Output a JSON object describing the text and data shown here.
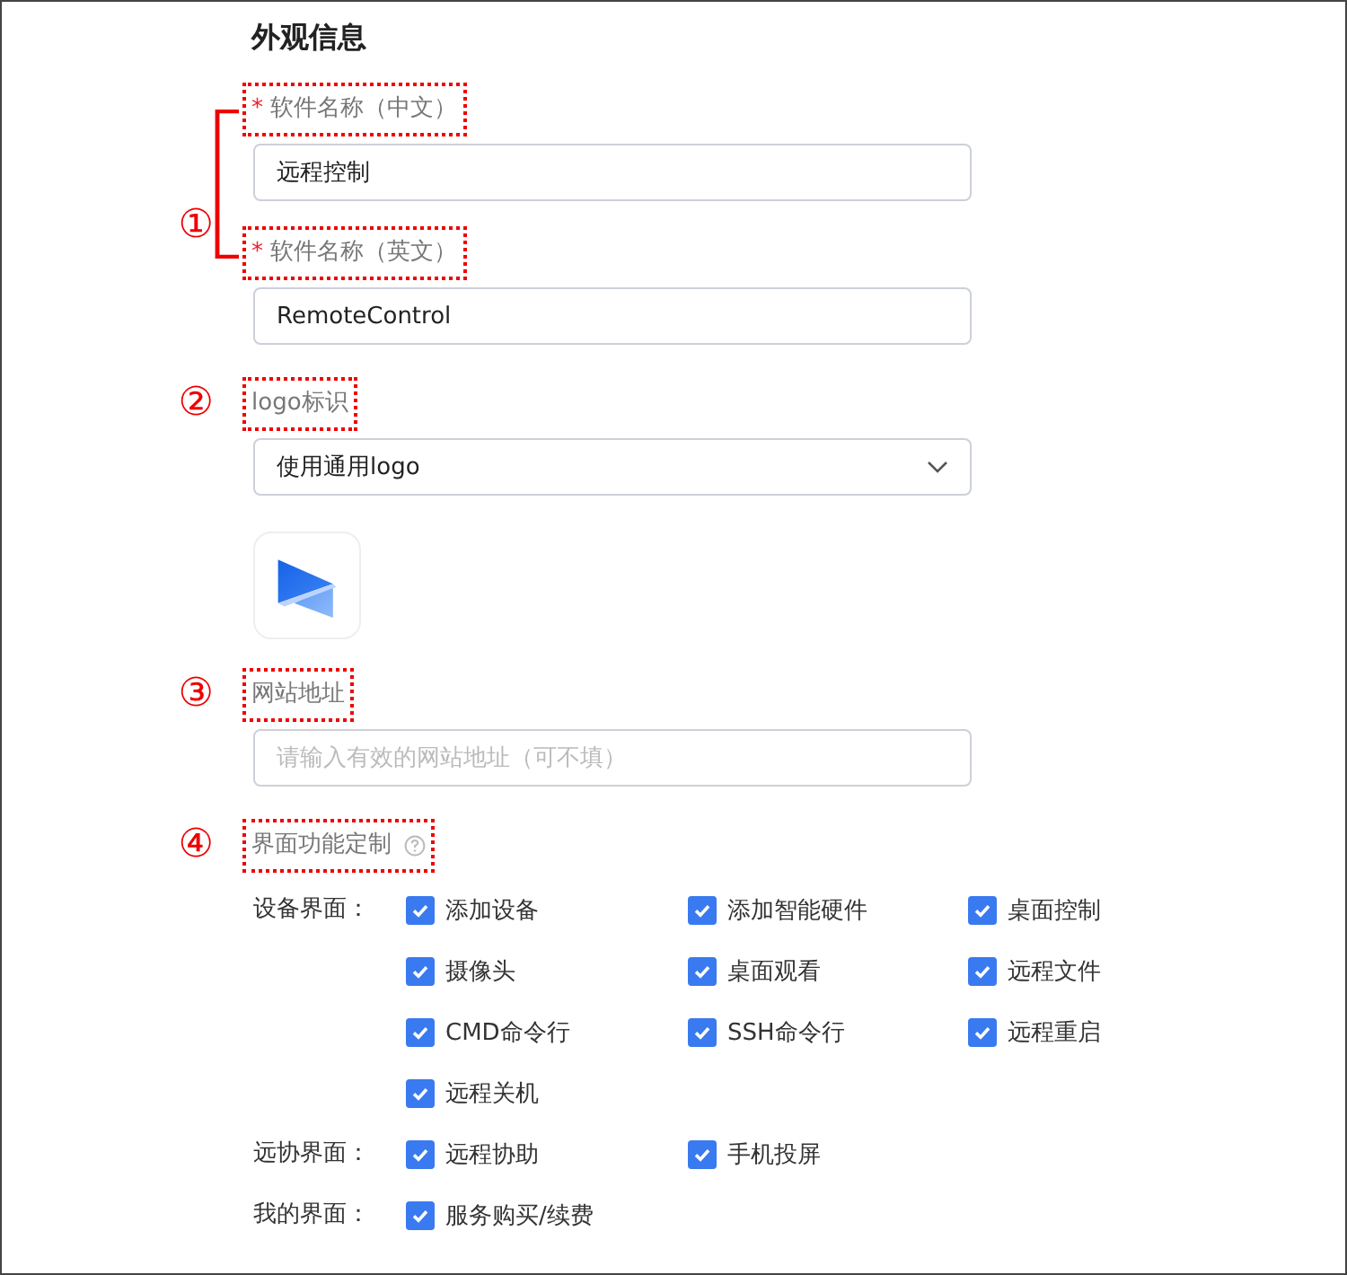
{
  "title": "外观信息",
  "sections": [
    {
      "marker": "①",
      "bracket": true,
      "fields": [
        {
          "kind": "text",
          "label": "软件名称（中文）",
          "required_mark": "*",
          "value": "远程控制"
        },
        {
          "kind": "text",
          "label": "软件名称（英文）",
          "required_mark": "*",
          "value": "RemoteControl"
        }
      ]
    },
    {
      "marker": "②",
      "bracket": false,
      "fields": [
        {
          "kind": "select",
          "label": "logo标识",
          "value": "使用通用logo"
        },
        {
          "kind": "logo"
        }
      ]
    },
    {
      "marker": "③",
      "bracket": false,
      "fields": [
        {
          "kind": "text",
          "label": "网站地址",
          "placeholder": "请输入有效的网站地址（可不填）"
        }
      ]
    },
    {
      "marker": "④",
      "bracket": false,
      "fields": [
        {
          "kind": "checks",
          "label": "界面功能定制",
          "help_icon": true,
          "groups": [
            {
              "label": "设备界面：",
              "options": [
                {
                  "label": "添加设备",
                  "checked": true
                },
                {
                  "label": "添加智能硬件",
                  "checked": true
                },
                {
                  "label": "桌面控制",
                  "checked": true
                },
                {
                  "label": "摄像头",
                  "checked": true
                },
                {
                  "label": "桌面观看",
                  "checked": true
                },
                {
                  "label": "远程文件",
                  "checked": true
                },
                {
                  "label": "CMD命令行",
                  "checked": true
                },
                {
                  "label": "SSH命令行",
                  "checked": true
                },
                {
                  "label": "远程重启",
                  "checked": true
                },
                {
                  "label": "远程关机",
                  "checked": true
                }
              ]
            },
            {
              "label": "远协界面：",
              "options": [
                {
                  "label": "远程协助",
                  "checked": true
                },
                {
                  "label": "手机投屏",
                  "checked": true
                }
              ]
            },
            {
              "label": "我的界面：",
              "options": [
                {
                  "label": "服务购买/续费",
                  "checked": true
                }
              ]
            }
          ]
        }
      ]
    }
  ]
}
